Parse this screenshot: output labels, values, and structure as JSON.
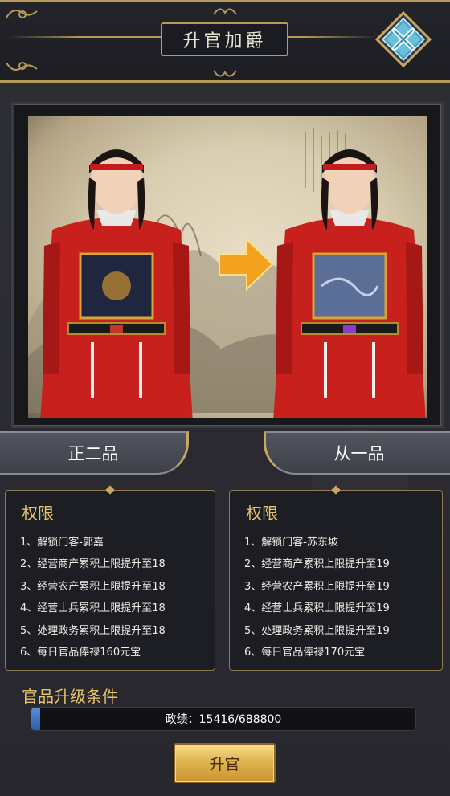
{
  "header": {
    "title": "升官加爵",
    "close_icon": "close-x-icon"
  },
  "ranks": {
    "current": "正二品",
    "next": "从一品"
  },
  "permissions": {
    "left": {
      "title": "权限",
      "items": [
        "1、解锁门客-郭嘉",
        "2、经营商产累积上限提升至18",
        "3、经营农产累积上限提升至18",
        "4、经营士兵累积上限提升至18",
        "5、处理政务累积上限提升至18",
        "6、每日官品俸禄160元宝"
      ]
    },
    "right": {
      "title": "权限",
      "items": [
        "1、解锁门客-苏东坡",
        "2、经营商产累积上限提升至19",
        "3、经营农产累积上限提升至19",
        "4、经营士兵累积上限提升至19",
        "5、处理政务累积上限提升至19",
        "6、每日官品俸禄170元宝"
      ]
    }
  },
  "conditions": {
    "title": "官品升级条件",
    "progress_text": "政绩：15416/688800",
    "progress_fraction": 0.022
  },
  "actions": {
    "promote_label": "升官"
  },
  "colors": {
    "gold": "#e6c46a",
    "robe": "#c8201c",
    "arrow": "#f2a21e",
    "progress": "#3f73c4"
  }
}
